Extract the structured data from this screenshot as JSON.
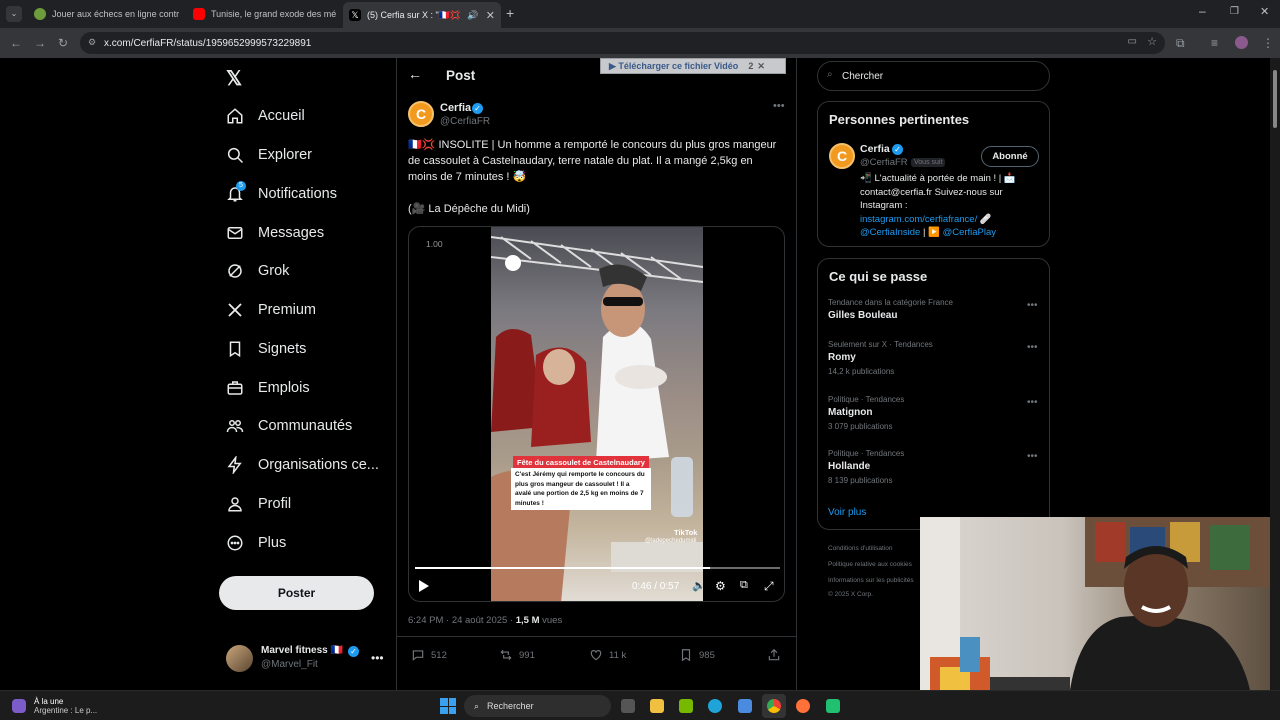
{
  "browser": {
    "tabs": [
      {
        "title": "Jouer aux échecs en ligne contr",
        "color": "#6d9c3a"
      },
      {
        "title": "Tunisie, le grand exode des mé",
        "color": "#ff0000"
      },
      {
        "title": "(5) Cerfia sur X : \"🇫🇷💢 INSOL",
        "color": "#000000"
      }
    ],
    "url": "x.com/CerfiaFR/status/1959652999573229891"
  },
  "nav": {
    "items": [
      {
        "label": "Accueil",
        "icon": "home-icon"
      },
      {
        "label": "Explorer",
        "icon": "search-icon"
      },
      {
        "label": "Notifications",
        "icon": "bell-icon"
      },
      {
        "label": "Messages",
        "icon": "mail-icon"
      },
      {
        "label": "Grok",
        "icon": "grok-icon"
      },
      {
        "label": "Premium",
        "icon": "x-logo-icon"
      },
      {
        "label": "Signets",
        "icon": "bookmark-icon"
      },
      {
        "label": "Emplois",
        "icon": "briefcase-icon"
      },
      {
        "label": "Communautés",
        "icon": "people-icon"
      },
      {
        "label": "Organisations ce...",
        "icon": "lightning-icon"
      },
      {
        "label": "Profil",
        "icon": "person-icon"
      },
      {
        "label": "Plus",
        "icon": "more-circle-icon"
      }
    ],
    "notif_badge": "5",
    "post_button": "Poster",
    "account": {
      "name": "Marvel fitness 🇫🇷",
      "handle": "@Marvel_Fit"
    }
  },
  "post": {
    "header": "Post",
    "download_bar": "▶ Télécharger ce fichier Vidéo",
    "download_badge": "2",
    "author": {
      "name": "Cerfia",
      "handle": "@CerfiaFR"
    },
    "text": "🇫🇷💢 INSOLITE | Un homme a remporté le concours du plus gros mangeur de cassoulet à Castelnaudary, terre natale du plat. Il a mangé 2,5kg en moins de 7 minutes ! 🤯",
    "source": "(🎥 La Dépêche du Midi)",
    "video": {
      "speed": "1.00",
      "caption_title": "Fête du cassoulet de Castelnaudary",
      "caption_body": "C'est Jérémy qui remporte le concours du plus gros mangeur de cassoulet ! Il a avalé une portion de 2,5 kg en moins de 7 minutes !",
      "tiktok": "TikTok",
      "tiktok_handle": "@ladepechedumidi",
      "time": "0:46 / 0:57",
      "progress": 0.807
    },
    "timestamp": "6:24 PM · 24 août 2025 · ",
    "views_count": "1,5 M",
    "views_label": " vues",
    "stats": {
      "replies": "512",
      "reposts": "991",
      "likes": "11 k",
      "bookmarks": "985"
    }
  },
  "sidebar": {
    "search_placeholder": "Chercher",
    "relevant": {
      "title": "Personnes pertinentes",
      "name": "Cerfia",
      "handle": "@CerfiaFR",
      "follows_you": "Vous suit",
      "follow_button": "Abonné",
      "bio_1": "📲 L'actualité à portée de main ! | 📩",
      "bio_2": "contact@cerfia.fr Suivez-nous sur",
      "bio_3": "Instagram :",
      "bio_link": "instagram.com/cerfiafrance/",
      "bio_4_a": "@CerfiaInside",
      "bio_4_b": " | ▶️ ",
      "bio_4_c": "@CerfiaPlay"
    },
    "trends": {
      "title": "Ce qui se passe",
      "items": [
        {
          "category": "Tendance dans la catégorie France",
          "name": "Gilles Bouleau",
          "count": ""
        },
        {
          "category": "Seulement sur X · Tendances",
          "name": "Romy",
          "count": "14,2 k publications"
        },
        {
          "category": "Politique · Tendances",
          "name": "Matignon",
          "count": "3 079 publications"
        },
        {
          "category": "Politique · Tendances",
          "name": "Hollande",
          "count": "8 139 publications"
        }
      ],
      "see_more": "Voir plus"
    },
    "footer": [
      "Conditions d'utilisation",
      "Politique relative aux cookies",
      "Informations sur les publicités",
      "© 2025 X Corp."
    ]
  },
  "taskbar": {
    "news_title": "À la une",
    "news_sub": "Argentine : Le p...",
    "search": "Rechercher"
  },
  "colors": {
    "accent": "#1d9bf0",
    "link": "#1d9bf0",
    "caption_red": "#e0333c"
  }
}
